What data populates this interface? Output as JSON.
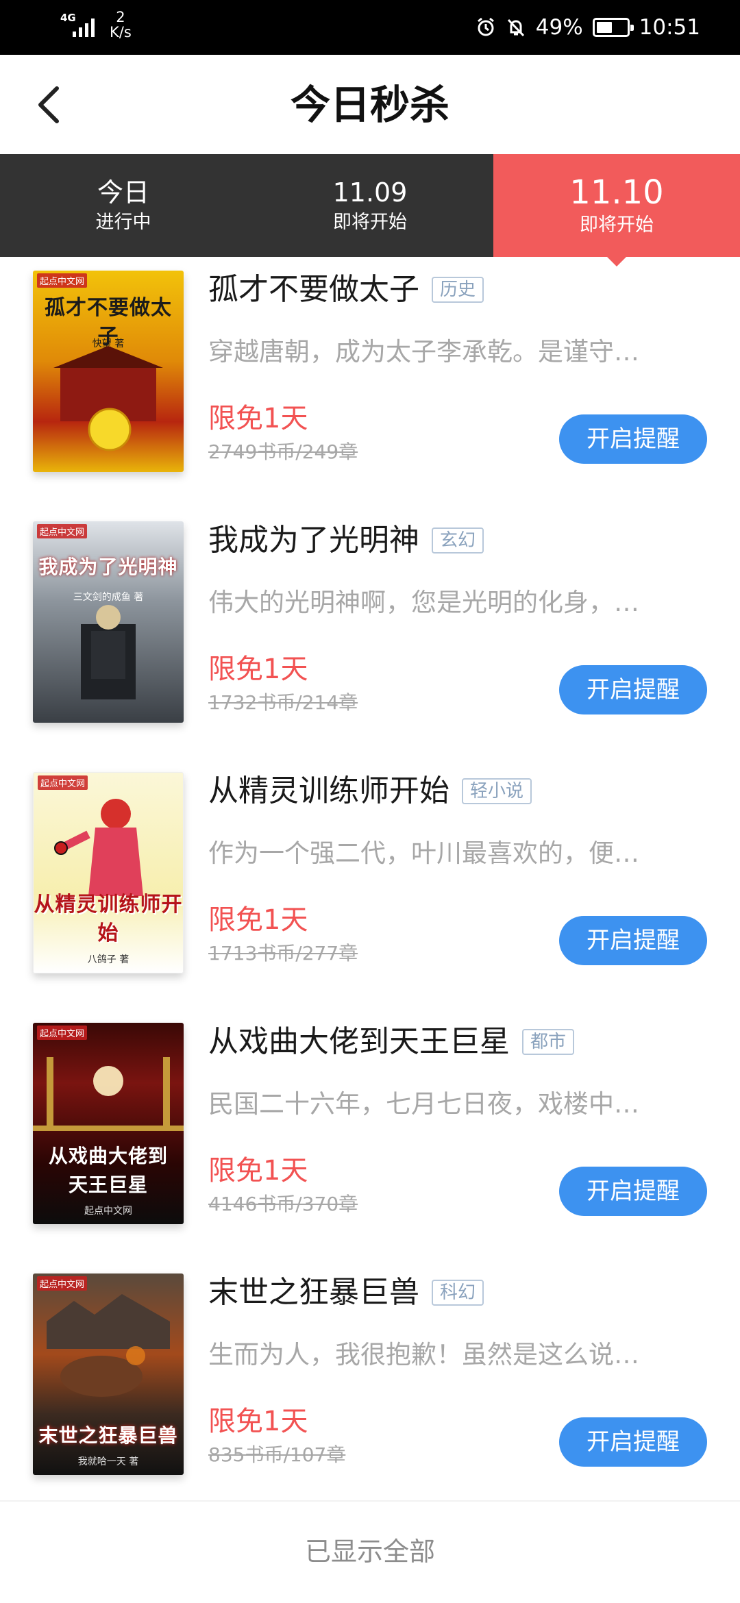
{
  "status_bar": {
    "network": "4G",
    "speed_value": "2",
    "speed_unit": "K/s",
    "battery": "49%",
    "time": "10:51",
    "icons": [
      "alarm-icon",
      "mute-icon",
      "battery-icon"
    ]
  },
  "header": {
    "title": "今日秒杀",
    "back_icon": "chevron-left-icon"
  },
  "tabs": [
    {
      "label": "今日",
      "sub": "进行中",
      "active": false
    },
    {
      "label": "11.09",
      "sub": "即将开始",
      "active": false
    },
    {
      "label": "11.10",
      "sub": "即将开始",
      "active": true
    }
  ],
  "books": [
    {
      "title": "孤才不要做太子",
      "genre": "历史",
      "desc": "穿越唐朝，成为太子李承乾。是谨守…",
      "free": "限免1天",
      "price": "2749书币/249章",
      "button": "开启提醒",
      "cover": {
        "logo": "起点中文网",
        "title": "孤才不要做太子",
        "author": "快望 著"
      }
    },
    {
      "title": "我成为了光明神",
      "genre": "玄幻",
      "desc": "伟大的光明神啊，您是光明的化身，…",
      "free": "限免1天",
      "price": "1732书币/214章",
      "button": "开启提醒",
      "cover": {
        "logo": "起点中文网",
        "title": "我成为了光明神",
        "author": "三文剑的成鱼 著"
      }
    },
    {
      "title": "从精灵训练师开始",
      "genre": "轻小说",
      "desc": "作为一个强二代，叶川最喜欢的，便…",
      "free": "限免1天",
      "price": "1713书币/277章",
      "button": "开启提醒",
      "cover": {
        "logo": "起点中文网",
        "title": "从精灵训练师开始",
        "author": "八鸽子 著"
      }
    },
    {
      "title": "从戏曲大佬到天王巨星",
      "genre": "都市",
      "desc": "民国二十六年，七月七日夜，戏楼中…",
      "free": "限免1天",
      "price": "4146书币/370章",
      "button": "开启提醒",
      "cover": {
        "logo": "起点中文网",
        "title": "从戏曲大佬到天王巨星",
        "author": "起点中文网"
      }
    },
    {
      "title": "末世之狂暴巨兽",
      "genre": "科幻",
      "desc": "生而为人，我很抱歉！虽然是这么说…",
      "free": "限免1天",
      "price": "835书币/107章",
      "button": "开启提醒",
      "cover": {
        "logo": "起点中文网",
        "title": "末世之狂暴巨兽",
        "author": "我就哈一天 著"
      }
    }
  ],
  "footer": "已显示全部",
  "colors": {
    "accent_red": "#f25b5b",
    "button_blue": "#3d92f0",
    "tab_bar": "#333333"
  }
}
